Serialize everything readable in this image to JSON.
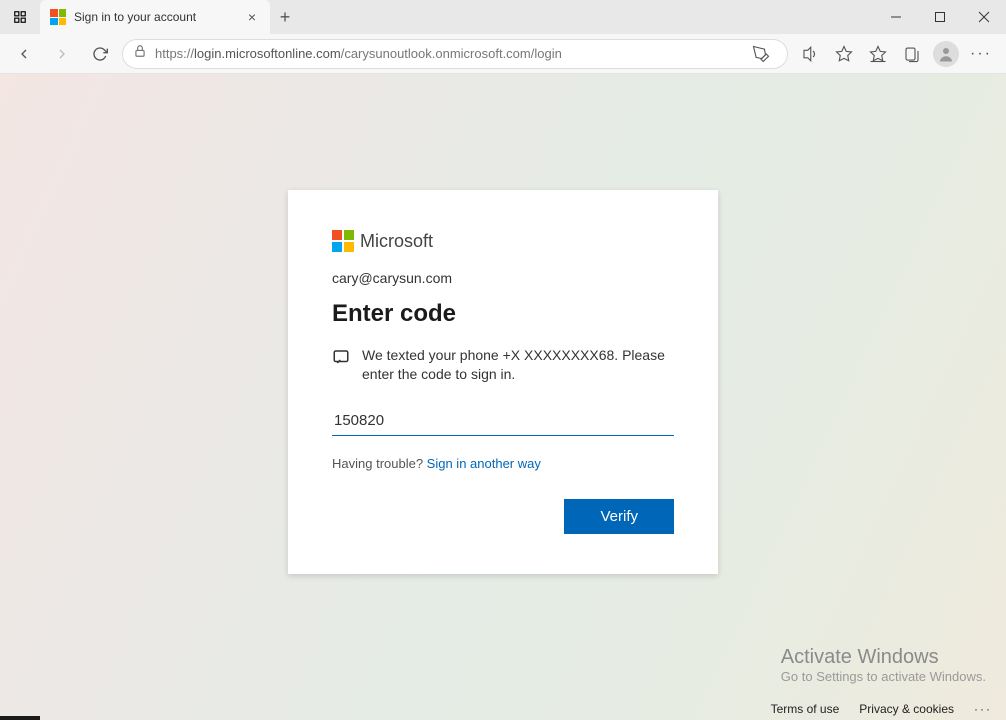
{
  "browser": {
    "tab_title": "Sign in to your account",
    "url_prefix": "https://",
    "url_bold": "login.microsoftonline.com",
    "url_rest": "/carysunoutlook.onmicrosoft.com/login"
  },
  "card": {
    "brand": "Microsoft",
    "account": "cary@carysun.com",
    "heading": "Enter code",
    "message": "We texted your phone +X XXXXXXXX68. Please enter the code to sign in.",
    "code_value": "150820",
    "trouble_prefix": "Having trouble? ",
    "trouble_link": "Sign in another way",
    "verify_label": "Verify"
  },
  "watermark": {
    "line1": "Activate Windows",
    "line2": "Go to Settings to activate Windows."
  },
  "footer": {
    "terms": "Terms of use",
    "privacy": "Privacy & cookies"
  }
}
